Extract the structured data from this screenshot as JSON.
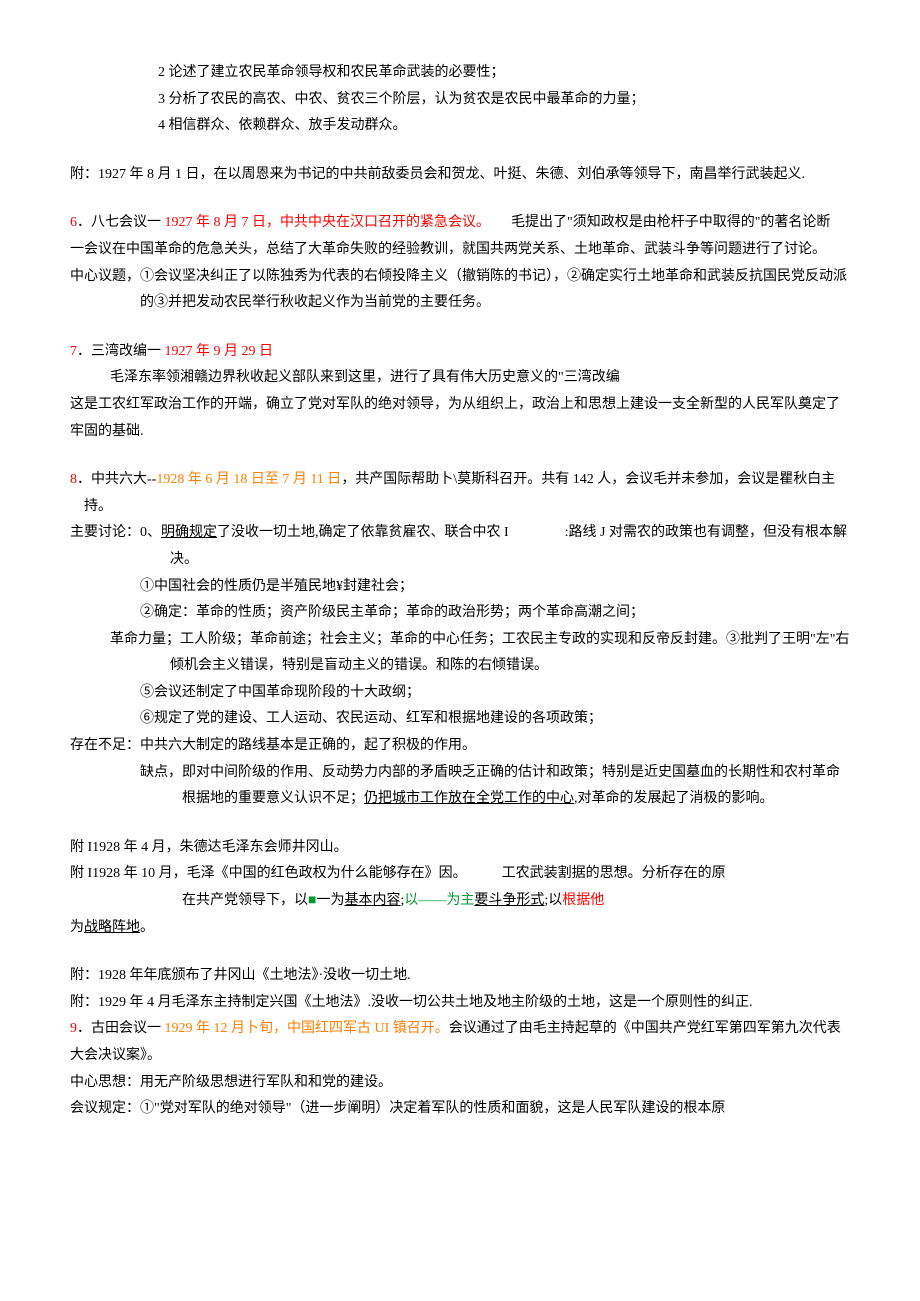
{
  "top": {
    "l1": "2 论述了建立农民革命领导权和农民革命武装的必要性；",
    "l2": "3 分析了农民的高农、中农、贫农三个阶层，认为贫农是农民中最革命的力量；",
    "l3": "4 相信群众、依赖群众、放手发动群众。"
  },
  "attach1": "附：1927 年 8 月 1 日，在以周恩来为书记的中共前敌委员会和贺龙、叶挺、朱德、刘伯承等领导下，南昌举行武装起义.",
  "s6": {
    "num": "6",
    "title_a": "．八七会议一 ",
    "title_red": "1927 年 8 月 7 日，中共中央在汉口召开的紧急会议。",
    "title_b": "　　毛提出了\"须知政权是由枪杆子中取得的\"的著名论断",
    "p1": "一会议在中国革命的危急关头，总结了大革命失败的经验教训，就国共两党关系、土地革命、武装斗争等问题进行了讨论。",
    "p2": "中心议题，①会议坚决纠正了以陈独秀为代表的右倾投降主义（撤销陈的书记），②确定实行土地革命和武装反抗国民党反动派的③并把发动农民举行秋收起义作为当前党的主要任务。"
  },
  "s7": {
    "num": "7",
    "title_a": "．三湾改编一 ",
    "title_red": "1927 年 9 月 29 日",
    "p1": "毛泽东率领湘赣边界秋收起义部队来到这里，进行了具有伟大历史意义的\"三湾改编",
    "p2": "这是工农红军政治工作的开端，确立了党对军队的绝对领导，为从组织上，政治上和思想上建设一支全新型的人民军队奠定了牢固的基础."
  },
  "s8": {
    "num": "8",
    "title_a": "．中共六大--",
    "title_orange": "1928 年 6 月 18 日至 7 月 11 日",
    "title_b": "，共产国际帮助卜\\莫斯科召开。共有 142 人，会议毛并未参加，会议是瞿秋白主持。",
    "d0a": "主要讨论：0、",
    "d0u": "明确规定",
    "d0b": "了没收一切土地,确定了依靠贫雇农、联合中农 I　　　　:路线 J 对需农的政策也有调整，但没有根本解决。",
    "d1": "①中国社会的性质仍是半殖民地¥封建社会；",
    "d2": "②确定：革命的性质；资产阶级民主革命；革命的政治形势；两个革命高潮之间；",
    "d3": "革命力量；工人阶级；革命前途；社会主义；革命的中心任务；工农民主专政的实现和反帝反封建。③批判了王明\"左\"右倾机会主义错误，特别是盲动主义的错误。和陈的右倾错误。",
    "d5": "⑤会议还制定了中国革命现阶段的十大政纲；",
    "d6": "⑥规定了党的建设、工人运动、农民运动、红军和根据地建设的各项政策；",
    "e1": "存在不足：中共六大制定的路线基本是正确的，起了积极的作用。",
    "e2a": "缺点，即对中间阶级的作用、反动势力内部的矛盾映乏正确的估计和政策；特别是近史国墓血的长期性和农村革命根据地的重要意义认识不足；",
    "e2u": "仍把城市工作放在全党工作的中心",
    "e2b": ",对革命的发展起了消极的影响。"
  },
  "mid": {
    "a1": "附 I1928 年 4 月，朱德达毛泽东会师井冈山。",
    "a2": "附 I1928 年 10 月，毛泽《中国的红色政权为什么能够存在》因。　　　工农武装割据的思想。分析存在的原",
    "a3a": "在共产党领导下，以",
    "a3b": "一为",
    "a3u1": "基本内容",
    "a3c": ";",
    "a3g": "以——为主",
    "a3u2": "要斗争形式",
    "a3d": ";以",
    "a3r": "根据他",
    "a4a": "为",
    "a4u": "战略阵地",
    "a4b": "。"
  },
  "bottom": {
    "b1": "附：1928 年年底颁布了井冈山《土地法》·没收一切土地.",
    "b2": "附：1929 年 4 月毛泽东主持制定兴国《土地法》.没收一切公共土地及地主阶级的土地，这是一个原则性的纠正."
  },
  "s9": {
    "num": "9",
    "title_a": "．古田会议一 ",
    "title_orange": "1929 年 12 月卜旬，中国红四军古 UI 镇召开。",
    "title_b": "会议通过了由毛主持起草的《中国共产党红军第四军第九次代表大会决议案》。",
    "p1": "中心思想：用无产阶级思想进行军队和和党的建设。",
    "p2": "会议规定：①\"党对军队的绝对领导\"（进一步阐明）决定着军队的性质和面貌，这是人民军队建设的根本原"
  }
}
